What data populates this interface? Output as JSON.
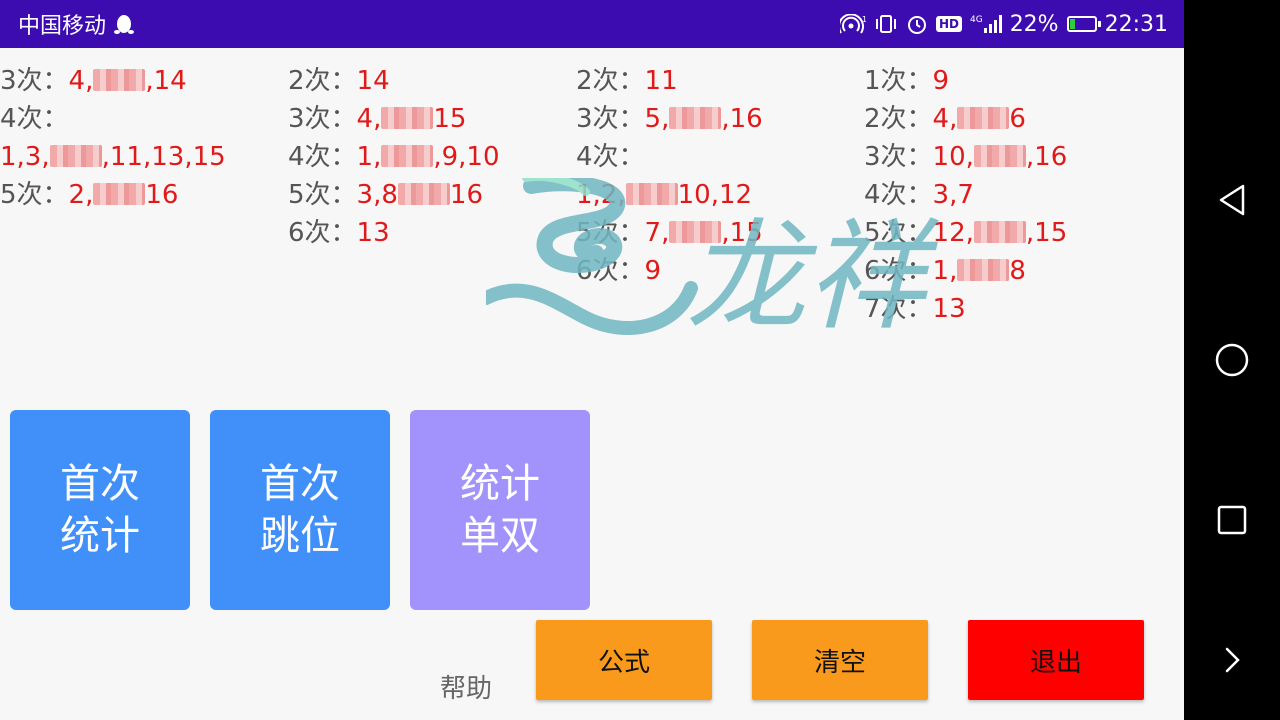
{
  "status_bar": {
    "carrier": "中国移动",
    "battery": "22%",
    "battery_level": 0.22,
    "time": "22:31",
    "net_label": "4G",
    "hd_label": "HD"
  },
  "columns": [
    [
      {
        "label": "3次：",
        "parts": [
          "4,",
          "",
          ",14"
        ]
      },
      {
        "label": "4次：",
        "parts": []
      },
      {
        "label": "",
        "parts": [
          "1,3,",
          "",
          ",11,13,15"
        ]
      },
      {
        "label": "5次：",
        "parts": [
          "2,",
          "",
          "16"
        ]
      }
    ],
    [
      {
        "label": "2次：",
        "parts": [
          "14"
        ]
      },
      {
        "label": "3次：",
        "parts": [
          "4,",
          "",
          "15"
        ]
      },
      {
        "label": "4次：",
        "parts": [
          "1,",
          "",
          ",9,10"
        ]
      },
      {
        "label": "5次：",
        "parts": [
          "3,8",
          "",
          "16"
        ]
      },
      {
        "label": "6次：",
        "parts": [
          "13"
        ]
      }
    ],
    [
      {
        "label": "2次：",
        "parts": [
          "11"
        ]
      },
      {
        "label": "3次：",
        "parts": [
          "5,",
          "",
          ",16"
        ]
      },
      {
        "label": "4次：",
        "parts": []
      },
      {
        "label": "",
        "parts": [
          "1,2,",
          "",
          "10,12"
        ]
      },
      {
        "label": "5次：",
        "parts": [
          "7,",
          "",
          ",15"
        ]
      },
      {
        "label": "6次：",
        "parts": [
          "9"
        ]
      }
    ],
    [
      {
        "label": "1次：",
        "parts": [
          "9"
        ]
      },
      {
        "label": "2次：",
        "parts": [
          "4,",
          "",
          "6"
        ]
      },
      {
        "label": "3次：",
        "parts": [
          "10,",
          "",
          ",16"
        ]
      },
      {
        "label": "4次：",
        "parts": [
          "3,7"
        ]
      },
      {
        "label": "5次：",
        "parts": [
          "12,",
          "",
          ",15"
        ]
      },
      {
        "label": "6次：",
        "parts": [
          "1,",
          "",
          "8"
        ]
      },
      {
        "label": "7次：",
        "parts": [
          "13"
        ]
      }
    ]
  ],
  "buttons": {
    "first_stats": "首次\n统计",
    "first_jump": "首次\n跳位",
    "stats_odd_even": "统计\n单双",
    "formula": "公式",
    "clear": "清空",
    "exit": "退出",
    "help": "帮助"
  },
  "watermark": {
    "text": "龙祥"
  },
  "colors": {
    "status_bar": "#3c0cb0",
    "label": "#555555",
    "value": "#e01919",
    "blue_button": "#418ff8",
    "purple_button": "#a292fb",
    "orange_button": "#f99a1d",
    "red_button": "#ff0000",
    "watermark": "#6fb7c3"
  }
}
